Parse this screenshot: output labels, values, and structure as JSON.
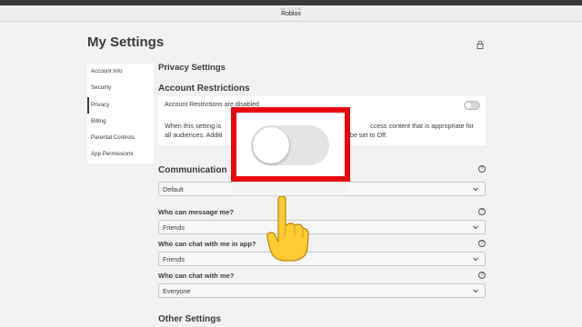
{
  "window": {
    "subtitle": "ios_1_1 7:16",
    "title": "Roblox"
  },
  "page_title": "My Settings",
  "sidebar": {
    "items": [
      {
        "label": "Account Info",
        "active": false
      },
      {
        "label": "Security",
        "active": false
      },
      {
        "label": "Privacy",
        "active": true
      },
      {
        "label": "Billing",
        "active": false
      },
      {
        "label": "Parental Controls",
        "active": false
      },
      {
        "label": "App Permissions",
        "active": false
      }
    ]
  },
  "privacy": {
    "heading": "Privacy Settings",
    "restrictions_heading": "Account Restrictions",
    "restrictions_status": "Account Restrictions are disabled",
    "restrictions_desc_left": "When this setting is",
    "restrictions_desc_right": "ccess content that is appropriate for",
    "restrictions_desc_left2": "all audiences. Additi",
    "restrictions_desc_right2": "vill be set to Off.",
    "toggle_on": false
  },
  "communication": {
    "heading": "Communication",
    "preset_value": "Default",
    "message_label": "Who can message me?",
    "message_value": "Friends",
    "chat_app_label": "Who can chat with me in app?",
    "chat_app_value": "Friends",
    "chat_label": "Who can chat with me?",
    "chat_value": "Everyone"
  },
  "other": {
    "heading": "Other Settings"
  },
  "colors": {
    "highlight": "#e8050f",
    "background": "#f2f2f2",
    "text": "#393b3d"
  },
  "icons": {
    "lock": "lock-icon",
    "help": "help-icon",
    "chevron": "chevron-down-icon",
    "pointer": "pointing-hand-icon"
  }
}
